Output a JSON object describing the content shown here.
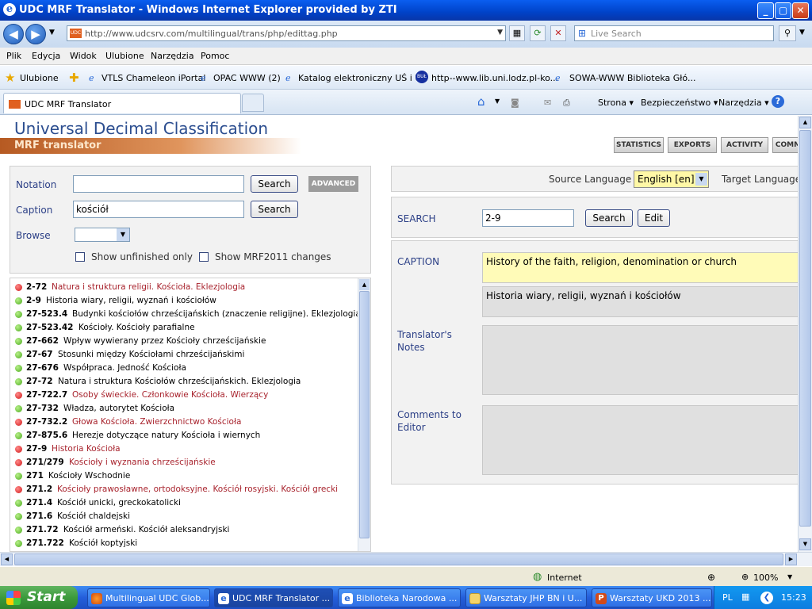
{
  "window": {
    "title": "UDC MRF Translator - Windows Internet Explorer provided by ZTI",
    "min": "_",
    "max": "▢",
    "close": "✕"
  },
  "address": {
    "url": "http://www.udcsrv.com/multilingual/trans/php/edittag.php",
    "favicon": "UDC",
    "live_search": "Live Search"
  },
  "menu": [
    "Plik",
    "Edycja",
    "Widok",
    "Ulubione",
    "Narzędzia",
    "Pomoc"
  ],
  "favorites": {
    "label": "Ulubione",
    "items": [
      "VTLS Chameleon iPortal",
      "OPAC WWW (2)",
      "Katalog elektroniczny UŚ i UE",
      "http--www.lib.uni.lodz.pl-ko...",
      "SOWA-WWW  Biblioteka Głó..."
    ]
  },
  "tab": {
    "label": "UDC MRF Translator",
    "tools": [
      "Strona ▾",
      "Bezpieczeństwo ▾",
      "Narzędzia ▾"
    ]
  },
  "page": {
    "title": "Universal Decimal Classification",
    "subtitle": "MRF translator",
    "top_buttons": [
      "STATISTICS",
      "EXPORTS",
      "ACTIVITY",
      "COMM"
    ],
    "search": {
      "notation_label": "Notation",
      "notation_value": "",
      "caption_label": "Caption",
      "caption_value": "kościół",
      "browse_label": "Browse",
      "search_btn": "Search",
      "advanced_btn": "ADVANCED",
      "unfinished_label": "Show unfinished only",
      "mrf_label": "Show MRF2011 changes"
    },
    "results": [
      {
        "code": "2-72",
        "text": "Natura i struktura religii. Kościoła. Eklezjologia",
        "status": "red"
      },
      {
        "code": "2-9",
        "text": "Historia wiary, religii, wyznań i kościołów",
        "status": "green"
      },
      {
        "code": "27-523.4",
        "text": "Budynki kościołów chrześcijańskich (znaczenie religijne). Eklezjologia",
        "status": "green"
      },
      {
        "code": "27-523.42",
        "text": "Kościoły. Kościoły parafialne",
        "status": "green"
      },
      {
        "code": "27-662",
        "text": "Wpływ wywierany przez Kościoły chrześcijańskie",
        "status": "green"
      },
      {
        "code": "27-67",
        "text": "Stosunki między Kościołami chrześcijańskimi",
        "status": "green"
      },
      {
        "code": "27-676",
        "text": "Współpraca. Jedność Kościoła",
        "status": "green"
      },
      {
        "code": "27-72",
        "text": "Natura i struktura Kościołów chrześcijańskich. Eklezjologia",
        "status": "green"
      },
      {
        "code": "27-722.7",
        "text": "Osoby świeckie. Członkowie Kościoła. Wierzący",
        "status": "red"
      },
      {
        "code": "27-732",
        "text": "Władza, autorytet Kościoła",
        "status": "green"
      },
      {
        "code": "27-732.2",
        "text": "Głowa Kościoła. Zwierzchnictwo Kościoła",
        "status": "red"
      },
      {
        "code": "27-875.6",
        "text": "Herezje dotyczące natury Kościoła i wiernych",
        "status": "green"
      },
      {
        "code": "27-9",
        "text": "Historia Kościoła",
        "status": "red"
      },
      {
        "code": "271/279",
        "text": "Kościoły i wyznania chrześcijańskie",
        "status": "red"
      },
      {
        "code": "271",
        "text": "Kościoły Wschodnie",
        "status": "green"
      },
      {
        "code": "271.2",
        "text": "Kościoły prawosławne, ortodoksyjne. Kościół rosyjski. Kościół grecki",
        "status": "red"
      },
      {
        "code": "271.4",
        "text": "Kościół unicki, greckokatolicki",
        "status": "green"
      },
      {
        "code": "271.6",
        "text": "Kościół chaldejski",
        "status": "green"
      },
      {
        "code": "271.72",
        "text": "Kościół armeński. Kościół aleksandryjski",
        "status": "green"
      },
      {
        "code": "271.722",
        "text": "Kościół koptyjski",
        "status": "green"
      }
    ],
    "right": {
      "source_lang_label": "Source Language",
      "source_lang_value": "English [en]",
      "target_lang_label": "Target Language",
      "search_label": "SEARCH",
      "search_value": "2-9",
      "search_btn": "Search",
      "edit_btn": "Edit",
      "caption_label": "CAPTION",
      "caption_en": "History of the faith, religion, denomination or church",
      "caption_pl": "Historia wiary, religii, wyznań i kościołów",
      "notes_label": "Translator's Notes",
      "comments_label": "Comments to Editor"
    }
  },
  "status": {
    "zone": "Internet",
    "zoom": "100%"
  },
  "taskbar": {
    "start": "Start",
    "tasks": [
      "Multilingual UDC Glob...",
      "UDC MRF Translator ...",
      "Biblioteka Narodowa ...",
      "Warsztaty JHP BN i U...",
      "Warsztaty UKD 2013 ..."
    ],
    "lang": "PL",
    "time": "15:23"
  },
  "colors": {
    "accent": "#2b4d8f",
    "orange": "#b65a22",
    "error_red": "#a8232d",
    "ok_green": "#4aaa1c"
  }
}
